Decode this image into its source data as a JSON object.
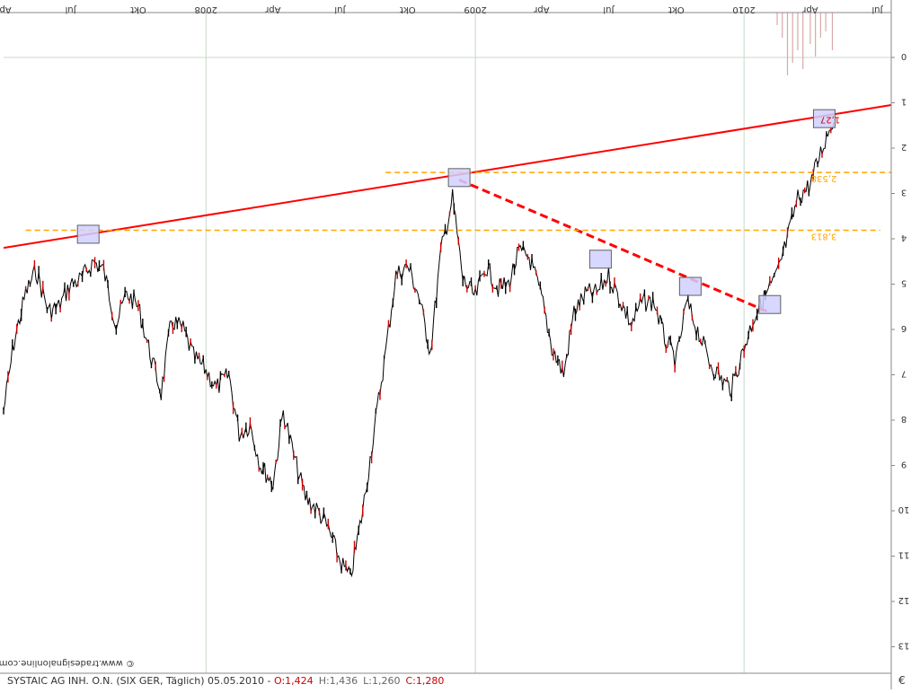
{
  "header": {
    "x_tick_labels": [
      "Apr",
      "Jul",
      "Okt",
      "2008",
      "Apr",
      "Jul",
      "Okt",
      "2009",
      "Apr",
      "Jul",
      "Okt",
      "2010",
      "Apr",
      "Jul"
    ]
  },
  "footer": {
    "watermark": "© www.tradesignalonline.com",
    "instrument_text": "SYSTAIC AG INH. O.N. (SIX GER, Täglich) 05.05.2010 - ",
    "ohlc_open": "O:1,424",
    "ohlc_high": "H:1,436",
    "ohlc_low": "L:1,260",
    "ohlc_close": "C:1,280",
    "currency_label": "€"
  },
  "colors": {
    "trend_line": "#ff0000",
    "resistance_line": "#ffa500",
    "bar_up": "#000000",
    "bar_down": "#cc0000",
    "grid": "#c8d8c8",
    "volume": "#d8a8a8",
    "marker_fill": "#d0d0ff",
    "marker_stroke": "#606060",
    "ohlc_open_color": "#cc0000",
    "ohlc_high_color": "#666666",
    "ohlc_low_color": "#666666",
    "ohlc_close_color": "#cc0000"
  },
  "chart_data": {
    "type": "line",
    "title": "SYSTAIC AG INH. O.N.",
    "xlabel": "",
    "ylabel": "€",
    "x_range": [
      "2007-04-01",
      "2010-07-20"
    ],
    "ylim": [
      0,
      13.8
    ],
    "y_axis": "inverted",
    "grid": true,
    "y_ticks": [
      0,
      1,
      2,
      3,
      4,
      5,
      6,
      7,
      8,
      9,
      10,
      11,
      12,
      13
    ],
    "x_ticks": [
      {
        "date": "2007-04-01",
        "label": "Apr"
      },
      {
        "date": "2007-07-01",
        "label": "Jul"
      },
      {
        "date": "2007-10-01",
        "label": "Okt"
      },
      {
        "date": "2008-01-01",
        "label": "2008"
      },
      {
        "date": "2008-04-01",
        "label": "Apr"
      },
      {
        "date": "2008-07-01",
        "label": "Jul"
      },
      {
        "date": "2008-10-01",
        "label": "Okt"
      },
      {
        "date": "2009-01-01",
        "label": "2009"
      },
      {
        "date": "2009-04-01",
        "label": "Apr"
      },
      {
        "date": "2009-07-01",
        "label": "Jul"
      },
      {
        "date": "2009-10-01",
        "label": "Okt"
      },
      {
        "date": "2010-01-01",
        "label": "2010"
      },
      {
        "date": "2010-04-01",
        "label": "Apr"
      },
      {
        "date": "2010-07-01",
        "label": "Jul"
      }
    ],
    "series": [
      {
        "x": [
          "2007-04-01",
          "2007-04-15",
          "2007-05-01",
          "2007-05-15",
          "2007-06-01",
          "2007-06-15",
          "2007-07-01",
          "2007-07-15",
          "2007-08-01",
          "2007-08-15",
          "2007-09-01",
          "2007-09-15",
          "2007-10-01",
          "2007-10-15",
          "2007-11-01",
          "2007-11-15",
          "2007-12-01",
          "2007-12-15",
          "2008-01-01",
          "2008-01-15",
          "2008-02-01",
          "2008-02-15",
          "2008-03-01",
          "2008-03-15",
          "2008-04-01",
          "2008-04-15",
          "2008-05-01",
          "2008-05-15",
          "2008-06-01",
          "2008-06-15",
          "2008-07-01",
          "2008-07-15",
          "2008-08-01",
          "2008-08-15",
          "2008-09-01",
          "2008-09-15",
          "2008-10-01",
          "2008-10-15",
          "2008-11-01",
          "2008-11-15",
          "2008-12-01",
          "2008-12-15",
          "2009-01-01",
          "2009-01-15",
          "2009-02-01",
          "2009-02-15",
          "2009-03-01",
          "2009-03-15",
          "2009-04-01",
          "2009-04-15",
          "2009-05-01",
          "2009-05-15",
          "2009-06-01",
          "2009-06-15",
          "2009-07-01",
          "2009-07-15",
          "2009-08-01",
          "2009-08-15",
          "2009-09-01",
          "2009-09-15",
          "2009-10-01",
          "2009-10-15",
          "2009-11-01",
          "2009-11-15",
          "2009-12-01",
          "2009-12-15",
          "2010-01-01",
          "2010-01-15",
          "2010-02-01",
          "2010-02-15",
          "2010-03-01",
          "2010-03-15",
          "2010-04-01",
          "2010-04-15",
          "2010-05-01",
          "2010-05-05"
        ],
        "values": [
          7.8,
          6.3,
          5.2,
          4.7,
          5.6,
          5.5,
          5.0,
          4.9,
          4.5,
          4.7,
          5.9,
          5.2,
          5.5,
          6.4,
          7.4,
          5.8,
          6.0,
          6.6,
          6.9,
          7.3,
          7.0,
          8.3,
          8.1,
          9.0,
          9.4,
          7.8,
          8.9,
          9.7,
          10.0,
          10.4,
          11.1,
          11.5,
          10.0,
          8.4,
          6.5,
          4.8,
          4.6,
          5.2,
          6.5,
          4.3,
          3.1,
          4.9,
          5.3,
          4.6,
          5.1,
          5.0,
          4.3,
          4.4,
          5.3,
          6.4,
          7.0,
          5.6,
          5.2,
          5.2,
          4.8,
          5.3,
          5.9,
          5.4,
          5.4,
          6.2,
          6.7,
          5.4,
          6.1,
          6.7,
          7.1,
          7.3,
          6.4,
          5.7,
          5.2,
          4.8,
          4.0,
          3.1,
          2.8,
          2.1,
          1.4,
          1.28
        ]
      }
    ],
    "volume_bars": {
      "x": [
        "2010-02-15",
        "2010-02-22",
        "2010-03-01",
        "2010-03-08",
        "2010-03-15",
        "2010-03-22",
        "2010-04-01",
        "2010-04-08",
        "2010-04-15",
        "2010-04-22",
        "2010-05-01"
      ],
      "values": [
        0.2,
        0.4,
        1.0,
        0.8,
        0.6,
        0.9,
        0.5,
        0.7,
        0.4,
        0.3,
        0.6
      ]
    },
    "annotations": [
      {
        "type": "trendline",
        "x1": "2007-04-01",
        "y1": 4.2,
        "x2": "2010-07-20",
        "y2": 1.05,
        "style": "solid",
        "color_key": "trend_line"
      },
      {
        "type": "trendline",
        "x1": "2008-12-10",
        "y1": 2.7,
        "x2": "2010-02-01",
        "y2": 5.6,
        "style": "dashed",
        "color_key": "trend_line"
      },
      {
        "type": "hline",
        "x1": "2008-09-01",
        "x2": "2010-07-20",
        "y": 2.538,
        "label": "2,538"
      },
      {
        "type": "hline",
        "x1": "2007-05-01",
        "x2": "2010-07-05",
        "y": 3.813,
        "label": "3,813"
      },
      {
        "type": "marker",
        "x": "2007-07-25",
        "y": 3.9
      },
      {
        "type": "marker",
        "x": "2008-12-10",
        "y": 2.65
      },
      {
        "type": "marker",
        "x": "2009-06-20",
        "y": 4.45
      },
      {
        "type": "marker",
        "x": "2009-10-20",
        "y": 5.05
      },
      {
        "type": "marker",
        "x": "2010-02-05",
        "y": 5.45
      },
      {
        "type": "marker",
        "x": "2010-04-20",
        "y": 1.35
      },
      {
        "type": "value_label",
        "x": "2010-04-28",
        "y": 1.4,
        "text": "1,27"
      }
    ]
  }
}
